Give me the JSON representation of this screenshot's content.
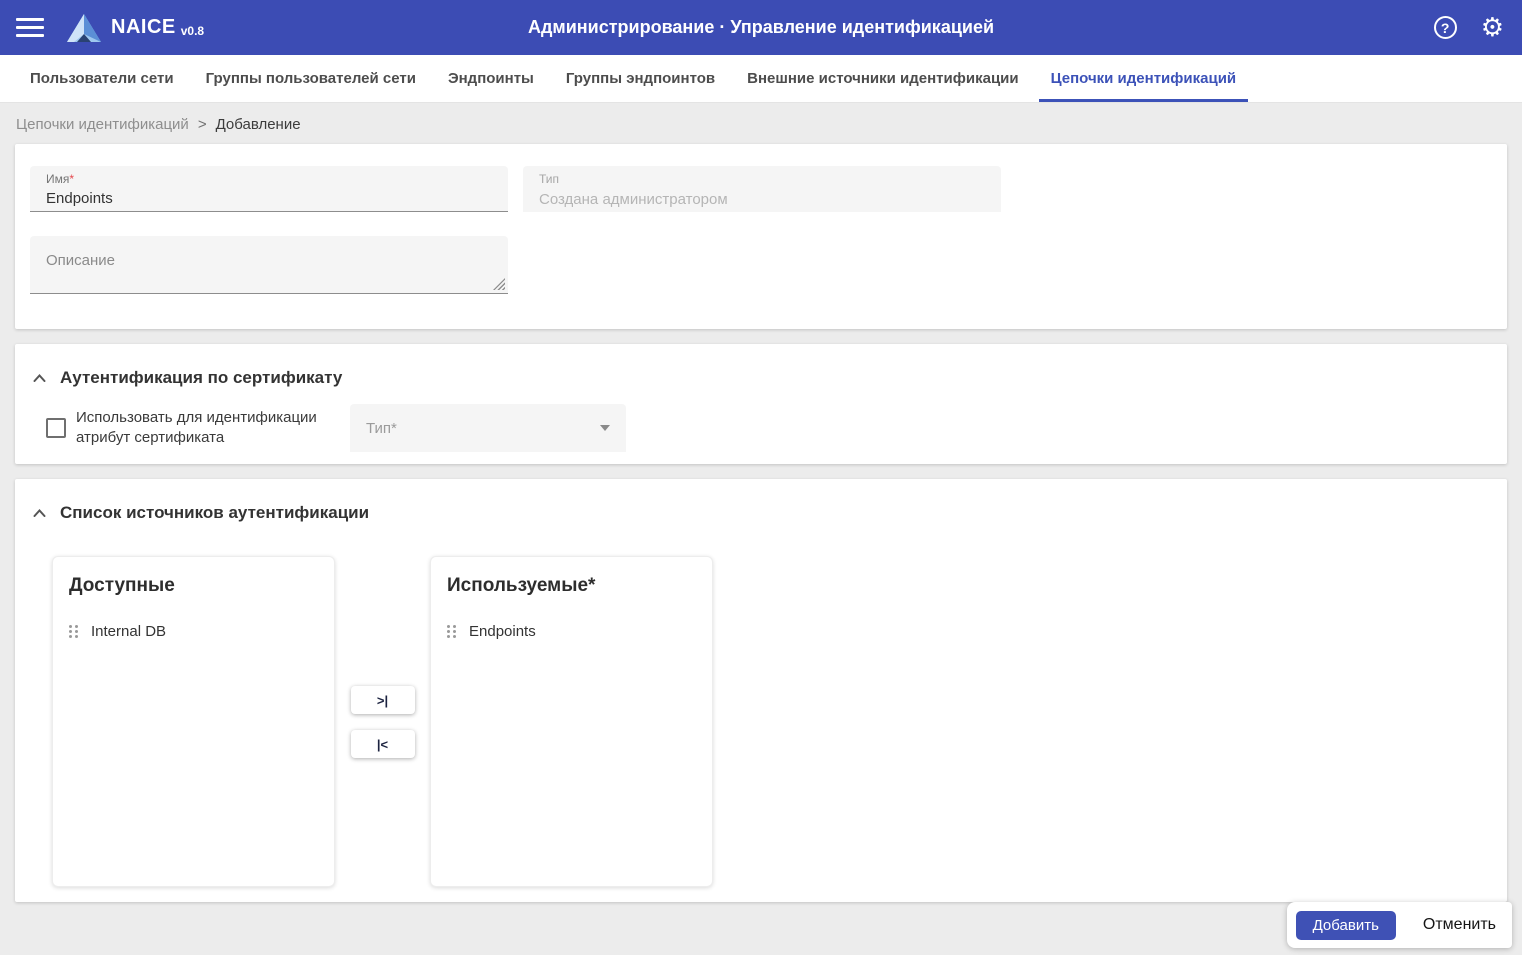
{
  "header": {
    "brand": "NAICE",
    "version": "v0.8",
    "title": "Администрирование · Управление идентификацией",
    "help_glyph": "?"
  },
  "tabs": [
    {
      "label": "Пользователи сети",
      "active": false
    },
    {
      "label": "Группы пользователей сети",
      "active": false
    },
    {
      "label": "Эндпоинты",
      "active": false
    },
    {
      "label": "Группы эндпоинтов",
      "active": false
    },
    {
      "label": "Внешние источники идентификации",
      "active": false
    },
    {
      "label": "Цепочки идентификаций",
      "active": true
    }
  ],
  "breadcrumb": {
    "parent": "Цепочки идентификаций",
    "separator": ">",
    "current": "Добавление"
  },
  "form": {
    "name_label": "Имя",
    "name_required": "*",
    "name_value": "Endpoints",
    "type_label": "Тип",
    "type_value": "Создана администратором",
    "description_label": "Описание"
  },
  "certificate_auth": {
    "title": "Аутентификация по сертификату",
    "checkbox_label": "Использовать для идентификации атрибут сертификата",
    "checkbox_checked": false,
    "type_select_placeholder": "Тип*"
  },
  "auth_sources": {
    "title": "Список источников аутентификации",
    "available_title": "Доступные",
    "available_items": [
      "Internal DB"
    ],
    "used_title": "Используемые*",
    "used_items": [
      "Endpoints"
    ],
    "move_all_right": ">|",
    "move_all_left": "|<"
  },
  "actions": {
    "submit": "Добавить",
    "cancel": "Отменить"
  },
  "colors": {
    "header_bg": "#3c4cb4",
    "primary": "#3f51b5",
    "active_tab": "#3c52b8",
    "page_bg": "#ececec",
    "required_red": "#e5484d",
    "field_bg": "#f5f5f5"
  }
}
